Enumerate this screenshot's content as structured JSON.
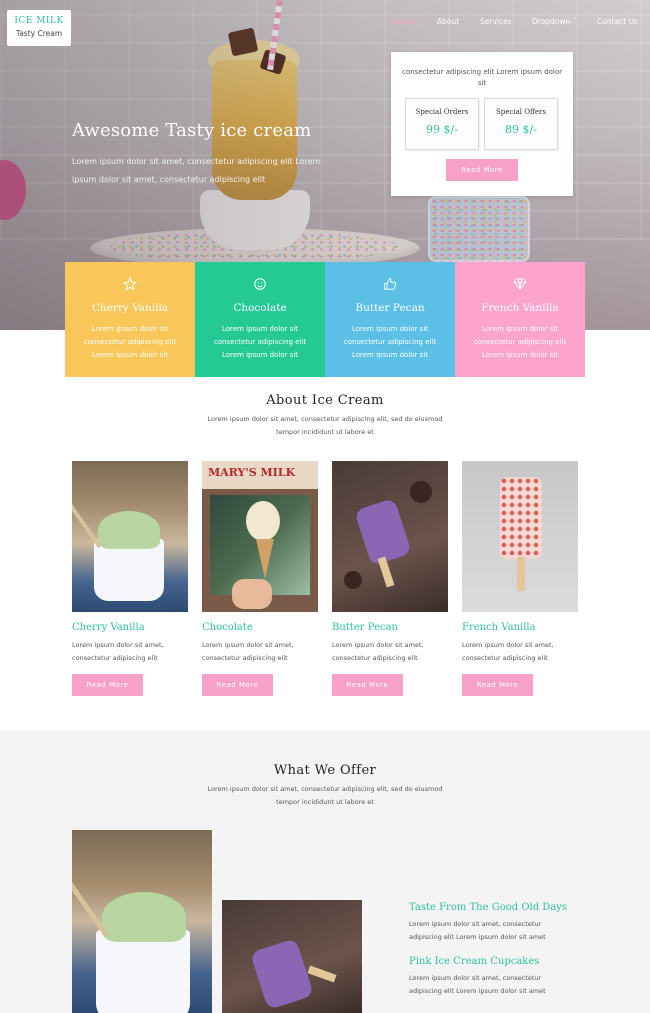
{
  "brand": {
    "line1": "ICE MILK",
    "line2": "Tasty Cream"
  },
  "nav": [
    {
      "label": "Home",
      "active": true
    },
    {
      "label": "About",
      "active": false
    },
    {
      "label": "Services",
      "active": false
    },
    {
      "label": "Dropdown ˅",
      "active": false
    },
    {
      "label": "Contact Us",
      "active": false
    }
  ],
  "hero": {
    "title": "Awesome Tasty ice cream",
    "subtitle": "Lorem ipsum dolor sit amet, consectetur adipiscing elit Lorem ipsum dolor sit amet, consectetur adipiscing elit"
  },
  "offer_box": {
    "description": "consectetur adipiscing elit Lorem ipsum dolor sit",
    "special_orders": {
      "title": "Special Orders",
      "price": "99 $/-"
    },
    "special_offers": {
      "title": "Special Offers",
      "price": "89 $/-"
    },
    "button": "Read More"
  },
  "flavors": [
    {
      "name": "Cherry Vanilla",
      "icon": "star-icon",
      "color": "#f9c759",
      "text": "Lorem ipsum dolor sit consectetur adipiscing elit Lorem ipsum dolor sit"
    },
    {
      "name": "Chocolate",
      "icon": "smiley-icon",
      "color": "#25c994",
      "text": "Lorem ipsum dolor sit consectetur adipiscing elit Lorem ipsum dolor sit"
    },
    {
      "name": "Butter Pecan",
      "icon": "thumbs-up-icon",
      "color": "#5bbfe6",
      "text": "Lorem ipsum dolor sit consectetur adipiscing elit Lorem ipsum dolor sit"
    },
    {
      "name": "French Vanilla",
      "icon": "diamond-icon",
      "color": "#fca3ce",
      "text": "Lorem ipsum dolor sit consectetur adipiscing elit Lorem ipsum dolor sit"
    }
  ],
  "about": {
    "title": "About Ice Cream",
    "subtitle": "Lorem ipsum dolor sit amet, consectetur adipiscing elit, sed do eiusmod tempor incididunt ut labore et",
    "items": [
      {
        "name": "Cherry Vanilla",
        "text": "Lorem ipsum dolor sit amet, consectetur adipiscing elit",
        "button": "Read More"
      },
      {
        "name": "Chocolate",
        "text": "Lorem ipsum dolor sit amet, consectetur adipiscing elit",
        "button": "Read More",
        "sign": "MARY'S MILK"
      },
      {
        "name": "Butter Pecan",
        "text": "Lorem ipsum dolor sit amet, consectetur adipiscing elit",
        "button": "Read More"
      },
      {
        "name": "French Vanilla",
        "text": "Lorem ipsum dolor sit amet, consectetur adipiscing elit",
        "button": "Read More"
      }
    ]
  },
  "offer": {
    "title": "What We Offer",
    "subtitle": "Lorem ipsum dolor sit amet, consectetur adipiscing elit, sed do eiusmod tempor incididunt ut labore et",
    "items": [
      {
        "heading": "Taste From The Good Old Days",
        "text": "Lorem ipsum dolor sit amet, consectetur adipiscing elit Lorem ipsum dolor sit amet"
      },
      {
        "heading": "Pink Ice Cream Cupcakes",
        "text": "Lorem ipsum dolor sit amet, consectetur adipiscing elit Lorem ipsum dolor sit amet"
      }
    ]
  },
  "colors": {
    "accent": "#2fbf9b",
    "pink": "#f7a1c8"
  }
}
